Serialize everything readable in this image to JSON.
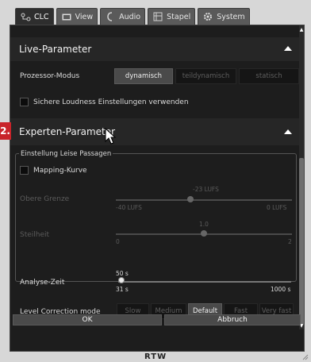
{
  "tabs": [
    {
      "label": "CLC",
      "icon": "clc-icon",
      "active": true
    },
    {
      "label": "View",
      "icon": "view-icon"
    },
    {
      "label": "Audio",
      "icon": "audio-icon"
    },
    {
      "label": "Stapel",
      "icon": "stack-icon"
    },
    {
      "label": "System",
      "icon": "gear-icon"
    }
  ],
  "live": {
    "title": "Live-Parameter",
    "processor_label": "Prozessor-Modus",
    "processor_options": [
      "dynamisch",
      "teildynamisch",
      "statisch"
    ],
    "processor_selected": "dynamisch",
    "safe_loudness_label": "Sichere Loudness Einstellungen verwenden",
    "safe_loudness_checked": false
  },
  "callout": {
    "number": "2."
  },
  "expert": {
    "title": "Experten-Parameter",
    "group_title": "Einstellung Leise Passagen",
    "mapping_label": "Mapping-Kurve",
    "mapping_checked": false,
    "upper_label": "Obere Grenze",
    "upper_value": "-23 LUFS",
    "upper_min": "-40 LUFS",
    "upper_max": "0 LUFS",
    "upper_fraction": 0.425,
    "slope_label": "Steilheit",
    "slope_value": "1.0",
    "slope_min": "0",
    "slope_max": "2",
    "slope_fraction": 0.5,
    "analysis_label": "Analyse-Zeit",
    "analysis_value": "50 s",
    "analysis_min": "31 s",
    "analysis_max": "1000 s",
    "analysis_fraction": 0.02,
    "level_label": "Level Correction mode",
    "level_options": [
      "Slow",
      "Medium",
      "Default",
      "Fast",
      "Very fast"
    ],
    "level_selected": "Default"
  },
  "footer": {
    "ok": "OK",
    "cancel": "Abbruch"
  },
  "brand": "RTW"
}
